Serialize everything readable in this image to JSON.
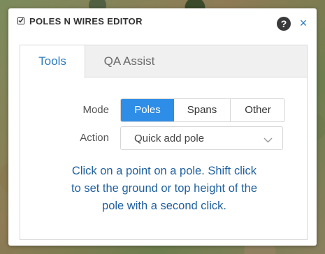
{
  "window": {
    "title": "POLES N WIRES EDITOR",
    "help_label": "?",
    "close_label": "×"
  },
  "tabs": [
    {
      "label": "Tools",
      "active": true
    },
    {
      "label": "QA Assist",
      "active": false
    }
  ],
  "mode": {
    "label": "Mode",
    "options": [
      "Poles",
      "Spans",
      "Other"
    ],
    "selected": "Poles"
  },
  "action": {
    "label": "Action",
    "selected": "Quick add pole"
  },
  "hint": {
    "line1": "Click on a point on a pole. Shift click",
    "line2": "to set the ground or top height of the",
    "line3": "pole with a second click."
  },
  "colors": {
    "accent": "#2e8de6",
    "tab_active_text": "#2e7bbf",
    "hint_text": "#1f5f9f"
  },
  "icons": [
    "checkbox-icon",
    "help-icon",
    "close-icon",
    "chevron-down-icon"
  ]
}
